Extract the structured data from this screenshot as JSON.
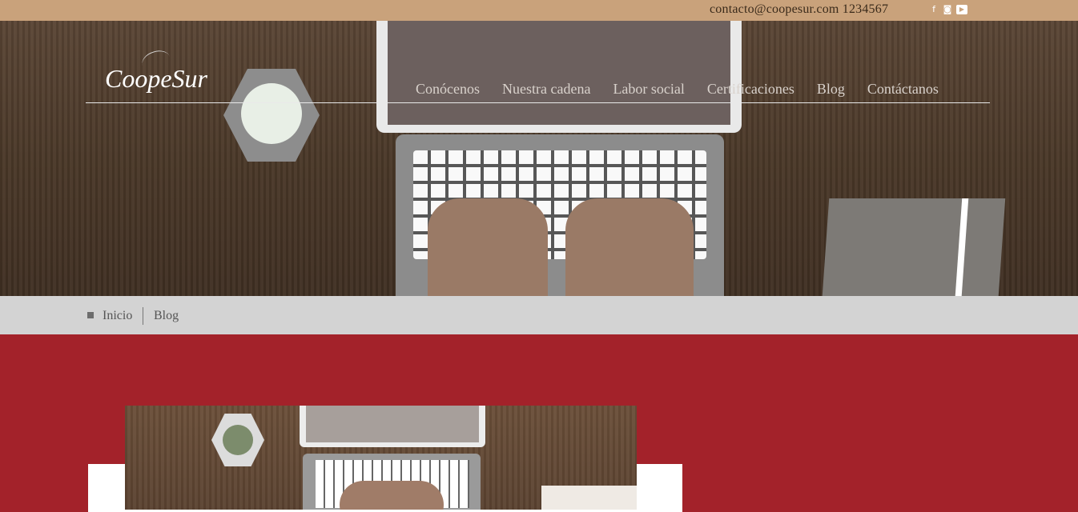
{
  "topbar": {
    "contact": "contacto@coopesur.com  1234567",
    "social": [
      "facebook-icon",
      "instagram-icon",
      "youtube-icon"
    ]
  },
  "brand": {
    "logo": "CoopeSur"
  },
  "nav": {
    "items": [
      {
        "label": "Conócenos"
      },
      {
        "label": "Nuestra cadena"
      },
      {
        "label": "Labor social"
      },
      {
        "label": "Certificaciones"
      },
      {
        "label": "Blog"
      },
      {
        "label": "Contáctanos"
      }
    ]
  },
  "breadcrumb": {
    "home": "Inicio",
    "current": "Blog"
  },
  "colors": {
    "topbar": "#c9a27b",
    "breadcrumb_bg": "#d3d3d3",
    "main_bg": "#a3222a",
    "card_bg": "#ffffff"
  }
}
